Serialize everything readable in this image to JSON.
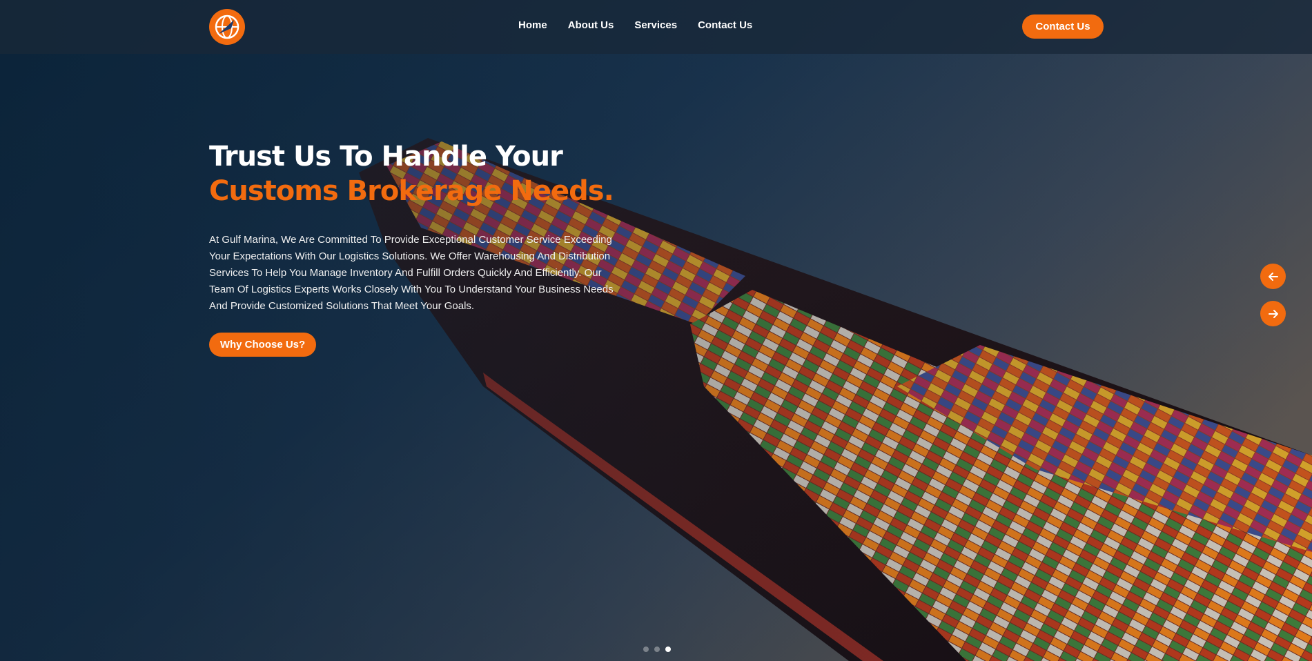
{
  "brand": {
    "logo_icon": "globe-plane-icon",
    "accent_color": "#f26b0f"
  },
  "nav": {
    "items": [
      {
        "label": "Home"
      },
      {
        "label": "About Us"
      },
      {
        "label": "Services"
      },
      {
        "label": "Contact Us"
      }
    ],
    "cta_label": "Contact Us"
  },
  "hero": {
    "title_line1": "Trust Us To Handle Your",
    "title_line2": "Customs Brokerage Needs.",
    "description": "At Gulf Marina, We Are Committed To Provide Exceptional Customer Service Exceeding Your Expectations With Our Logistics Solutions. We Offer Warehousing And Distribution Services To Help You Manage Inventory And Fulfill Orders Quickly And Efficiently. Our Team Of Logistics Experts Works Closely With You To Understand Your Business Needs And Provide Customized Solutions That Meet Your Goals.",
    "button_label": "Why Choose Us?",
    "background_image": "container-ship-aerial"
  },
  "slider": {
    "prev_icon": "arrow-left-icon",
    "next_icon": "arrow-right-icon",
    "slide_count": 3,
    "active_slide": 3
  }
}
